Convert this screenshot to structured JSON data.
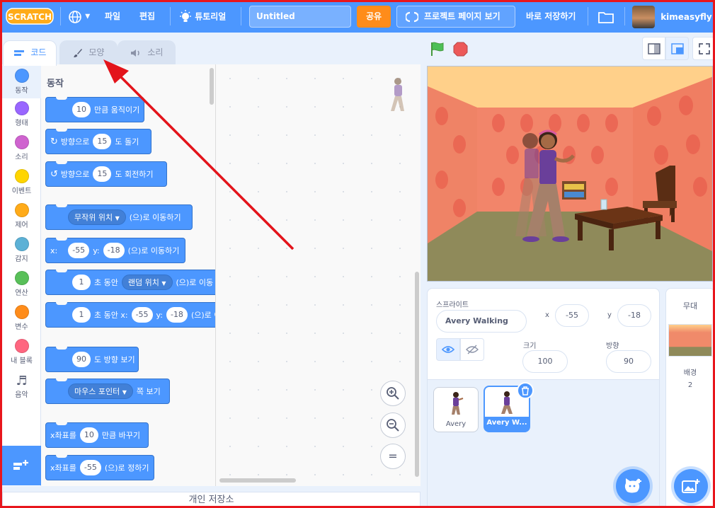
{
  "menu": {
    "logo_text": "SCRATCH",
    "file": "파일",
    "edit": "편집",
    "tutorials": "튜토리얼",
    "project_title": "Untitled",
    "share": "공유",
    "see_project_page": "프로젝트 페이지 보기",
    "save_now": "바로 저장하기",
    "username": "kimeasyfly"
  },
  "tabs": {
    "code": "코드",
    "costumes": "모양",
    "sounds": "소리"
  },
  "categories": [
    {
      "label": "동작",
      "color": "#4c97ff"
    },
    {
      "label": "형태",
      "color": "#9966ff"
    },
    {
      "label": "소리",
      "color": "#cf63cf"
    },
    {
      "label": "이벤트",
      "color": "#ffd500"
    },
    {
      "label": "제어",
      "color": "#ffab19"
    },
    {
      "label": "감지",
      "color": "#5cb1d6"
    },
    {
      "label": "연산",
      "color": "#59c059"
    },
    {
      "label": "변수",
      "color": "#ff8c1a"
    },
    {
      "label": "내 블록",
      "color": "#ff6680"
    },
    {
      "label": "음악",
      "color": ""
    }
  ],
  "palette": {
    "heading": "동작",
    "blocks": {
      "move": {
        "value": "10",
        "text": "만큼 움직이기"
      },
      "turn_right": {
        "pre": "방향으로",
        "value": "15",
        "text": "도 돌기"
      },
      "turn_left": {
        "pre": "방향으로",
        "value": "15",
        "text": "도 회전하기"
      },
      "goto": {
        "option": "무작위 위치",
        "text": "(으)로 이동하기"
      },
      "goto_xy": {
        "x_label": "x:",
        "x": "-55",
        "y_label": "y:",
        "y": "-18",
        "text": "(으)로 이동하기"
      },
      "glide": {
        "value": "1",
        "mid": "초 동안",
        "option": "랜덤 위치",
        "text": "(으)로 이동"
      },
      "glide_xy": {
        "value": "1",
        "mid": "초 동안 x:",
        "x": "-55",
        "y_label": "y:",
        "y": "-18",
        "text": "(으)로 이"
      },
      "point_dir": {
        "value": "90",
        "text": "도 방향 보기"
      },
      "point_towards": {
        "option": "마우스 포인터",
        "text": "쪽 보기"
      },
      "change_x": {
        "pre": "x좌표를",
        "value": "10",
        "text": "만큼 바꾸기"
      },
      "set_x": {
        "pre": "x좌표를",
        "value": "-55",
        "text": "(으)로 정하기"
      }
    }
  },
  "zoom": {
    "reset": "="
  },
  "backpack": "개인 저장소",
  "sprite_info": {
    "sprite_label": "스프라이트",
    "sprite_name": "Avery Walking",
    "x_label": "x",
    "x": "-55",
    "y_label": "y",
    "y": "-18",
    "show_label": "보이기",
    "size_label": "크기",
    "size": "100",
    "direction_label": "방향",
    "direction": "90"
  },
  "sprites": [
    {
      "name": "Avery"
    },
    {
      "name": "Avery W..."
    }
  ],
  "stage_panel": {
    "title": "무대",
    "backdrop_label": "배경",
    "backdrop_count": "2"
  },
  "colors": {
    "accent": "#4c97ff",
    "share": "#ff8c1a",
    "frame": "#e8161c",
    "arrow": "#e3141b"
  }
}
